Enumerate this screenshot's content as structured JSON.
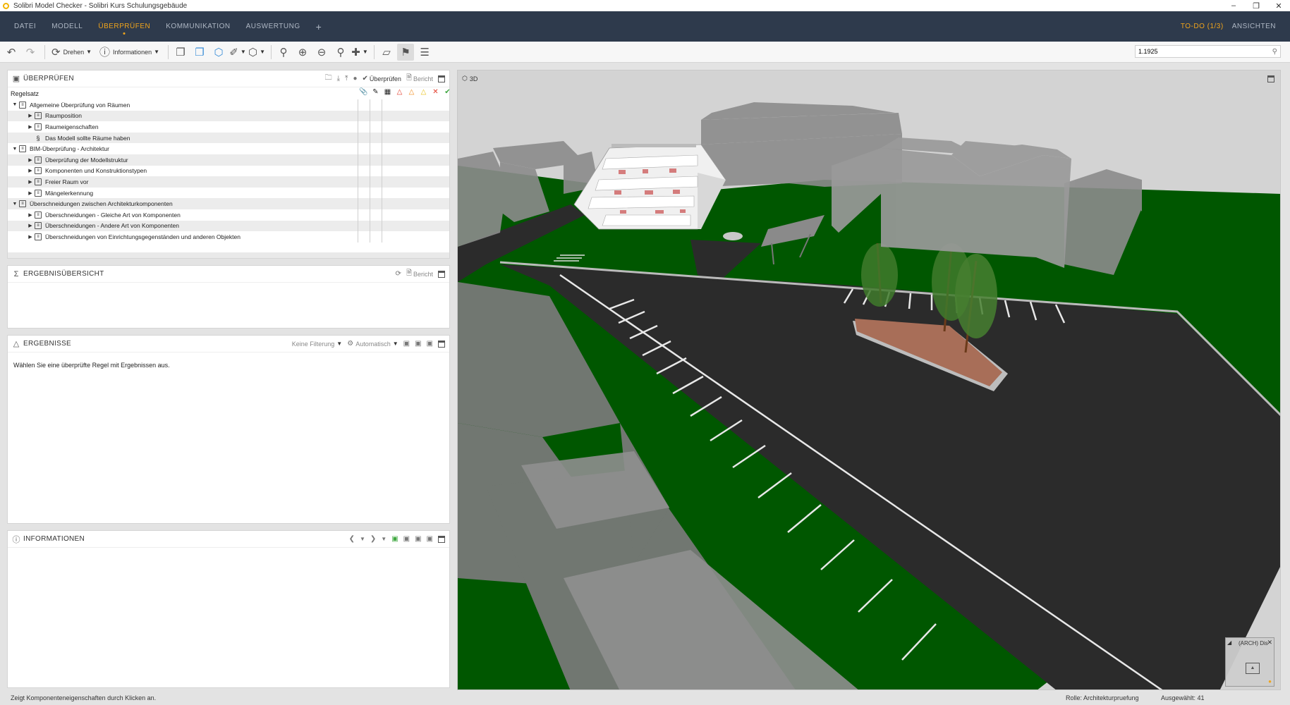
{
  "window": {
    "title": "Solibri Model Checker - Solibri Kurs Schulungsgebäude"
  },
  "menu": {
    "items": [
      "DATEI",
      "MODELL",
      "ÜBERPRÜFEN",
      "KOMMUNIKATION",
      "AUSWERTUNG"
    ],
    "active": "ÜBERPRÜFEN",
    "add": "+",
    "todo": "TO-DO (1/3)",
    "views": "ANSICHTEN"
  },
  "toolbar": {
    "rotate_label": "Drehen",
    "info_label": "Informationen",
    "search_value": "1.1925"
  },
  "check_panel": {
    "title": "ÜBERPRÜFEN",
    "check_label": "Überprüfen",
    "report_label": "Bericht",
    "column_header": "Regelsatz",
    "rows": [
      {
        "label": "Allgemeine Überprüfung von Räumen",
        "level": 0,
        "expand": "▼",
        "icon": "ruleset"
      },
      {
        "label": "Raumposition",
        "level": 1,
        "expand": "▶",
        "icon": "ruleset"
      },
      {
        "label": "Raumeigenschaften",
        "level": 1,
        "expand": "▶",
        "icon": "ruleset"
      },
      {
        "label": "Das Modell sollte Räume haben",
        "level": 1,
        "expand": "",
        "icon": "rule"
      },
      {
        "label": "BIM-Überprüfung - Architektur",
        "level": 0,
        "expand": "▼",
        "icon": "ruleset"
      },
      {
        "label": "Überprüfung der Modellstruktur",
        "level": 1,
        "expand": "▶",
        "icon": "ruleset"
      },
      {
        "label": "Komponenten und Konstruktionstypen",
        "level": 1,
        "expand": "▶",
        "icon": "ruleset"
      },
      {
        "label": "Freier Raum vor",
        "level": 1,
        "expand": "▶",
        "icon": "ruleset"
      },
      {
        "label": "Mängelerkennung",
        "level": 1,
        "expand": "▶",
        "icon": "ruleset"
      },
      {
        "label": "Überschneidungen zwischen Architekturkomponenten",
        "level": 0,
        "expand": "▼",
        "icon": "ruleset"
      },
      {
        "label": "Überschneidungen - Gleiche Art von Komponenten",
        "level": 1,
        "expand": "▶",
        "icon": "ruleset"
      },
      {
        "label": "Überschneidungen - Andere Art von Komponenten",
        "level": 1,
        "expand": "▶",
        "icon": "ruleset"
      },
      {
        "label": "Überschneidungen von Einrichtungsgegenständen und anderen Objekten",
        "level": 1,
        "expand": "▶",
        "icon": "ruleset"
      }
    ]
  },
  "summary_panel": {
    "title": "ERGEBNISÜBERSICHT",
    "report_label": "Bericht"
  },
  "results_panel": {
    "title": "ERGEBNISSE",
    "filter_label": "Keine Filterung",
    "auto_label": "Automatisch",
    "message": "Wählen Sie eine überprüfte Regel mit Ergebnissen aus."
  },
  "info_panel": {
    "title": "INFORMATIONEN"
  },
  "view3d": {
    "label": "3D",
    "minimap_label": "(ARCH) Dis"
  },
  "status": {
    "hint": "Zeigt Komponenteneigenschaften durch Klicken an.",
    "role": "Rolle: Architekturpruefung",
    "selected": "Ausgewählt: 41"
  },
  "colors": {
    "menubar": "#2e3a4c",
    "accent": "#f0a41b",
    "grass": "#005700",
    "asphalt": "#2b2b2b"
  }
}
